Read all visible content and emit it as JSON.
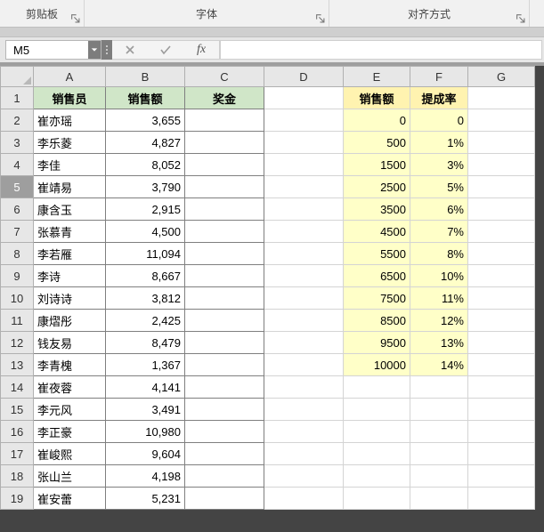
{
  "ribbon": {
    "clipboard": "剪贴板",
    "font": "字体",
    "alignment": "对齐方式"
  },
  "nameBox": "M5",
  "fx": "fx",
  "columns": [
    "A",
    "B",
    "C",
    "D",
    "E",
    "F",
    "G"
  ],
  "selectedRow": 5,
  "headerRow": {
    "A": "销售员",
    "B": "销售额",
    "C": "奖金",
    "E": "销售额",
    "F": "提成率"
  },
  "sales": [
    {
      "name": "崔亦瑶",
      "amount": "3,655"
    },
    {
      "name": "李乐菱",
      "amount": "4,827"
    },
    {
      "name": "李佳",
      "amount": "8,052"
    },
    {
      "name": "崔靖易",
      "amount": "3,790"
    },
    {
      "name": "康含玉",
      "amount": "2,915"
    },
    {
      "name": "张慕青",
      "amount": "4,500"
    },
    {
      "name": "李若雁",
      "amount": "11,094"
    },
    {
      "name": "李诗",
      "amount": "8,667"
    },
    {
      "name": "刘诗诗",
      "amount": "3,812"
    },
    {
      "name": "康熠彤",
      "amount": "2,425"
    },
    {
      "name": "钱友易",
      "amount": "8,479"
    },
    {
      "name": "李青槐",
      "amount": "1,367"
    },
    {
      "name": "崔夜蓉",
      "amount": "4,141"
    },
    {
      "name": "李元风",
      "amount": "3,491"
    },
    {
      "name": "李正豪",
      "amount": "10,980"
    },
    {
      "name": "崔峻熙",
      "amount": "9,604"
    },
    {
      "name": "张山兰",
      "amount": "4,198"
    },
    {
      "name": "崔安蕾",
      "amount": "5,231"
    }
  ],
  "tiers": [
    {
      "amount": "0",
      "rate": "0"
    },
    {
      "amount": "500",
      "rate": "1%"
    },
    {
      "amount": "1500",
      "rate": "3%"
    },
    {
      "amount": "2500",
      "rate": "5%"
    },
    {
      "amount": "3500",
      "rate": "6%"
    },
    {
      "amount": "4500",
      "rate": "7%"
    },
    {
      "amount": "5500",
      "rate": "8%"
    },
    {
      "amount": "6500",
      "rate": "10%"
    },
    {
      "amount": "7500",
      "rate": "11%"
    },
    {
      "amount": "8500",
      "rate": "12%"
    },
    {
      "amount": "9500",
      "rate": "13%"
    },
    {
      "amount": "10000",
      "rate": "14%"
    }
  ]
}
